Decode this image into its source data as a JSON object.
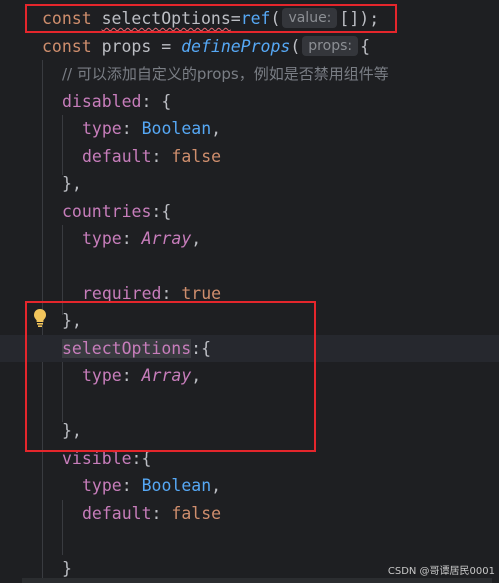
{
  "editor": {
    "line1": {
      "kw": "const",
      "ident": "selectOptions",
      "eq": "=",
      "fn": "ref",
      "open": "(",
      "hint": "value:",
      "rest": "[]);"
    },
    "line2": {
      "kw": "const",
      "ident": " props = ",
      "fn": "defineProps",
      "open": "(",
      "hint": "props:",
      "rest": "{"
    },
    "line3": {
      "comment": "// 可以添加自定义的props，例如是否禁用组件等"
    },
    "line4": {
      "prop": "disabled",
      "rest": ": {"
    },
    "line5": {
      "prop": "type",
      "sep": ": ",
      "value": "Boolean",
      "rest": ","
    },
    "line6": {
      "prop": "default",
      "sep": ": ",
      "value": "false"
    },
    "line7": {
      "text": "},"
    },
    "line8": {
      "prop": "countries",
      "rest": ":{"
    },
    "line9": {
      "prop": "type",
      "sep": ": ",
      "value": "Array",
      "rest": ","
    },
    "line11": {
      "prop": "required",
      "sep": ": ",
      "value": "true"
    },
    "line12": {
      "text": "},"
    },
    "line13": {
      "prop": "selectOptions",
      "rest": ":{"
    },
    "line14": {
      "prop": "type",
      "sep": ": ",
      "value": "Array",
      "rest": ","
    },
    "line16": {
      "text": "},"
    },
    "line17": {
      "prop": "visible",
      "rest": ":{"
    },
    "line18": {
      "prop": "type",
      "sep": ": ",
      "value": "Boolean",
      "rest": ","
    },
    "line19": {
      "prop": "default",
      "sep": ": ",
      "value": "false"
    },
    "line21": {
      "text": "}"
    }
  },
  "watermark": "CSDN @哥谭居民0001",
  "colors": {
    "highlight_box": "#e5262c",
    "background": "#1e1f22"
  }
}
